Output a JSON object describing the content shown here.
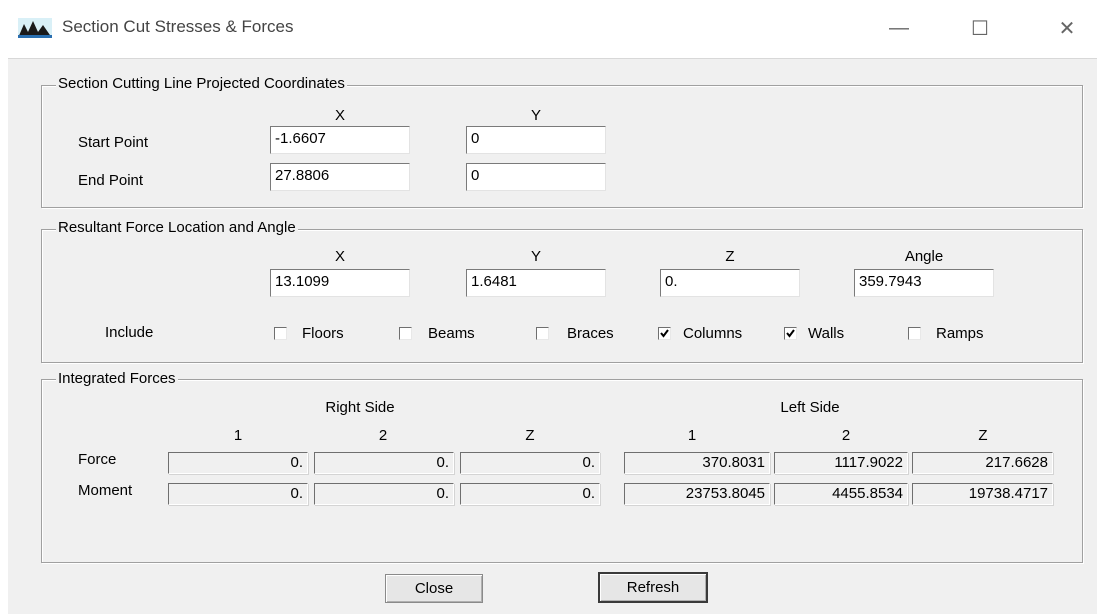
{
  "window": {
    "title": "Section Cut Stresses & Forces",
    "icon": "app-mountain-icon",
    "controls": {
      "minimize": "—",
      "maximize": "☐",
      "close": "✕"
    }
  },
  "projected": {
    "legend": "Section Cutting Line Projected Coordinates",
    "col_x": "X",
    "col_y": "Y",
    "start_label": "Start Point",
    "start_x": "-1.6607",
    "start_y": "0",
    "end_label": "End Point",
    "end_x": "27.8806",
    "end_y": "0"
  },
  "resultant": {
    "legend": "Resultant Force Location and Angle",
    "col_x": "X",
    "col_y": "Y",
    "col_z": "Z",
    "col_angle": "Angle",
    "x": "13.1099",
    "y": "1.6481",
    "z": "0.",
    "angle": "359.7943",
    "include_label": "Include",
    "include": [
      {
        "label": "Floors",
        "checked": false
      },
      {
        "label": "Beams",
        "checked": false
      },
      {
        "label": "Braces",
        "checked": false
      },
      {
        "label": "Columns",
        "checked": true
      },
      {
        "label": "Walls",
        "checked": true
      },
      {
        "label": "Ramps",
        "checked": false
      }
    ]
  },
  "integrated": {
    "legend": "Integrated Forces",
    "right_side": "Right Side",
    "left_side": "Left Side",
    "col_1": "1",
    "col_2": "2",
    "col_z": "Z",
    "force_label": "Force",
    "moment_label": "Moment",
    "force_right": [
      "0.",
      "0.",
      "0."
    ],
    "force_left": [
      "370.8031",
      "1117.9022",
      "217.6628"
    ],
    "moment_right": [
      "0.",
      "0.",
      "0."
    ],
    "moment_left": [
      "23753.8045",
      "4455.8534",
      "19738.4717"
    ]
  },
  "buttons": {
    "close": "Close",
    "refresh": "Refresh"
  }
}
